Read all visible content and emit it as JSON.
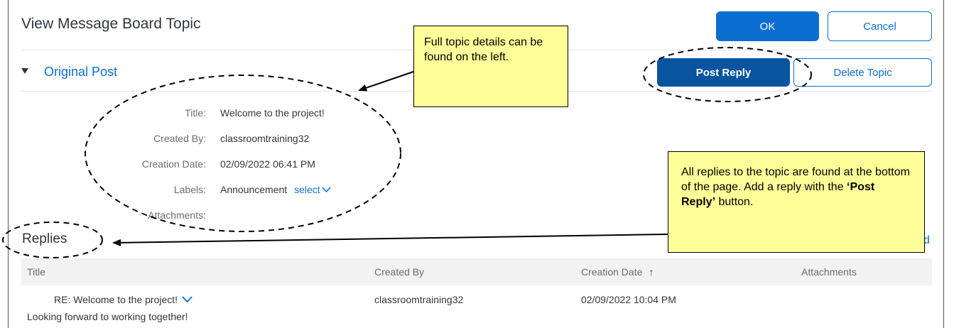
{
  "header": {
    "title": "View Message Board Topic",
    "ok_label": "OK",
    "cancel_label": "Cancel"
  },
  "original_post": {
    "section_title": "Original Post",
    "post_reply_label": "Post Reply",
    "delete_topic_label": "Delete Topic",
    "fields": {
      "title_label": "Title:",
      "title_value": "Welcome to the project!",
      "created_by_label": "Created By:",
      "created_by_value": "classroomtraining32",
      "creation_date_label": "Creation Date:",
      "creation_date_value": "02/09/2022 06:41 PM",
      "labels_label": "Labels:",
      "labels_value": "Announcement",
      "labels_select": "select",
      "attachments_label": "Attachments:"
    }
  },
  "replies": {
    "section_title": "Replies",
    "partial_link": "d",
    "columns": {
      "title": "Title",
      "created_by": "Created By",
      "creation_date": "Creation Date",
      "sort_icon": "↑",
      "attachments": "Attachments"
    },
    "rows": [
      {
        "title": "RE: Welcome to the project!",
        "body": "Looking forward to working together!",
        "created_by": "classroomtraining32",
        "creation_date": "02/09/2022 10:04 PM"
      }
    ]
  },
  "callouts": {
    "details": "Full topic details can be found on the left.",
    "replies_line1": "All replies to the topic are found at the bottom of the page. Add a reply with the ",
    "replies_bold": "‘Post Reply’",
    "replies_line2": " button."
  },
  "colors": {
    "accent": "#0a6ed1",
    "post_reply_bg": "#0854a0",
    "callout_bg": "#ffff99"
  }
}
